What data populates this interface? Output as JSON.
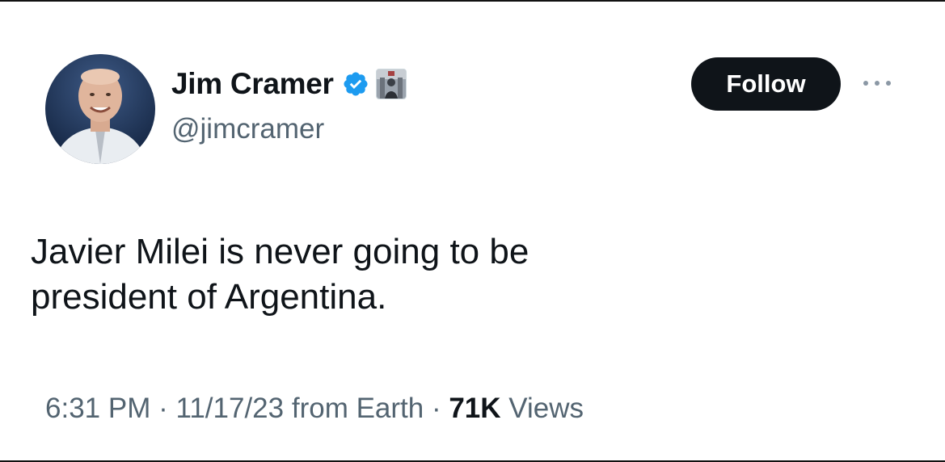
{
  "author": {
    "display_name": "Jim Cramer",
    "handle": "@jimcramer",
    "verified": true,
    "verified_color": "#1d9bf0"
  },
  "actions": {
    "follow_label": "Follow",
    "more_icon": "more-dots-icon"
  },
  "tweet": {
    "text_line1": "Javier Milei is never going to be",
    "text_line2": "president of Argentina."
  },
  "meta": {
    "time": "6:31 PM",
    "separator": " · ",
    "date": "11/17/23",
    "source": " from Earth",
    "views_count": "71K",
    "views_label": " Views"
  }
}
